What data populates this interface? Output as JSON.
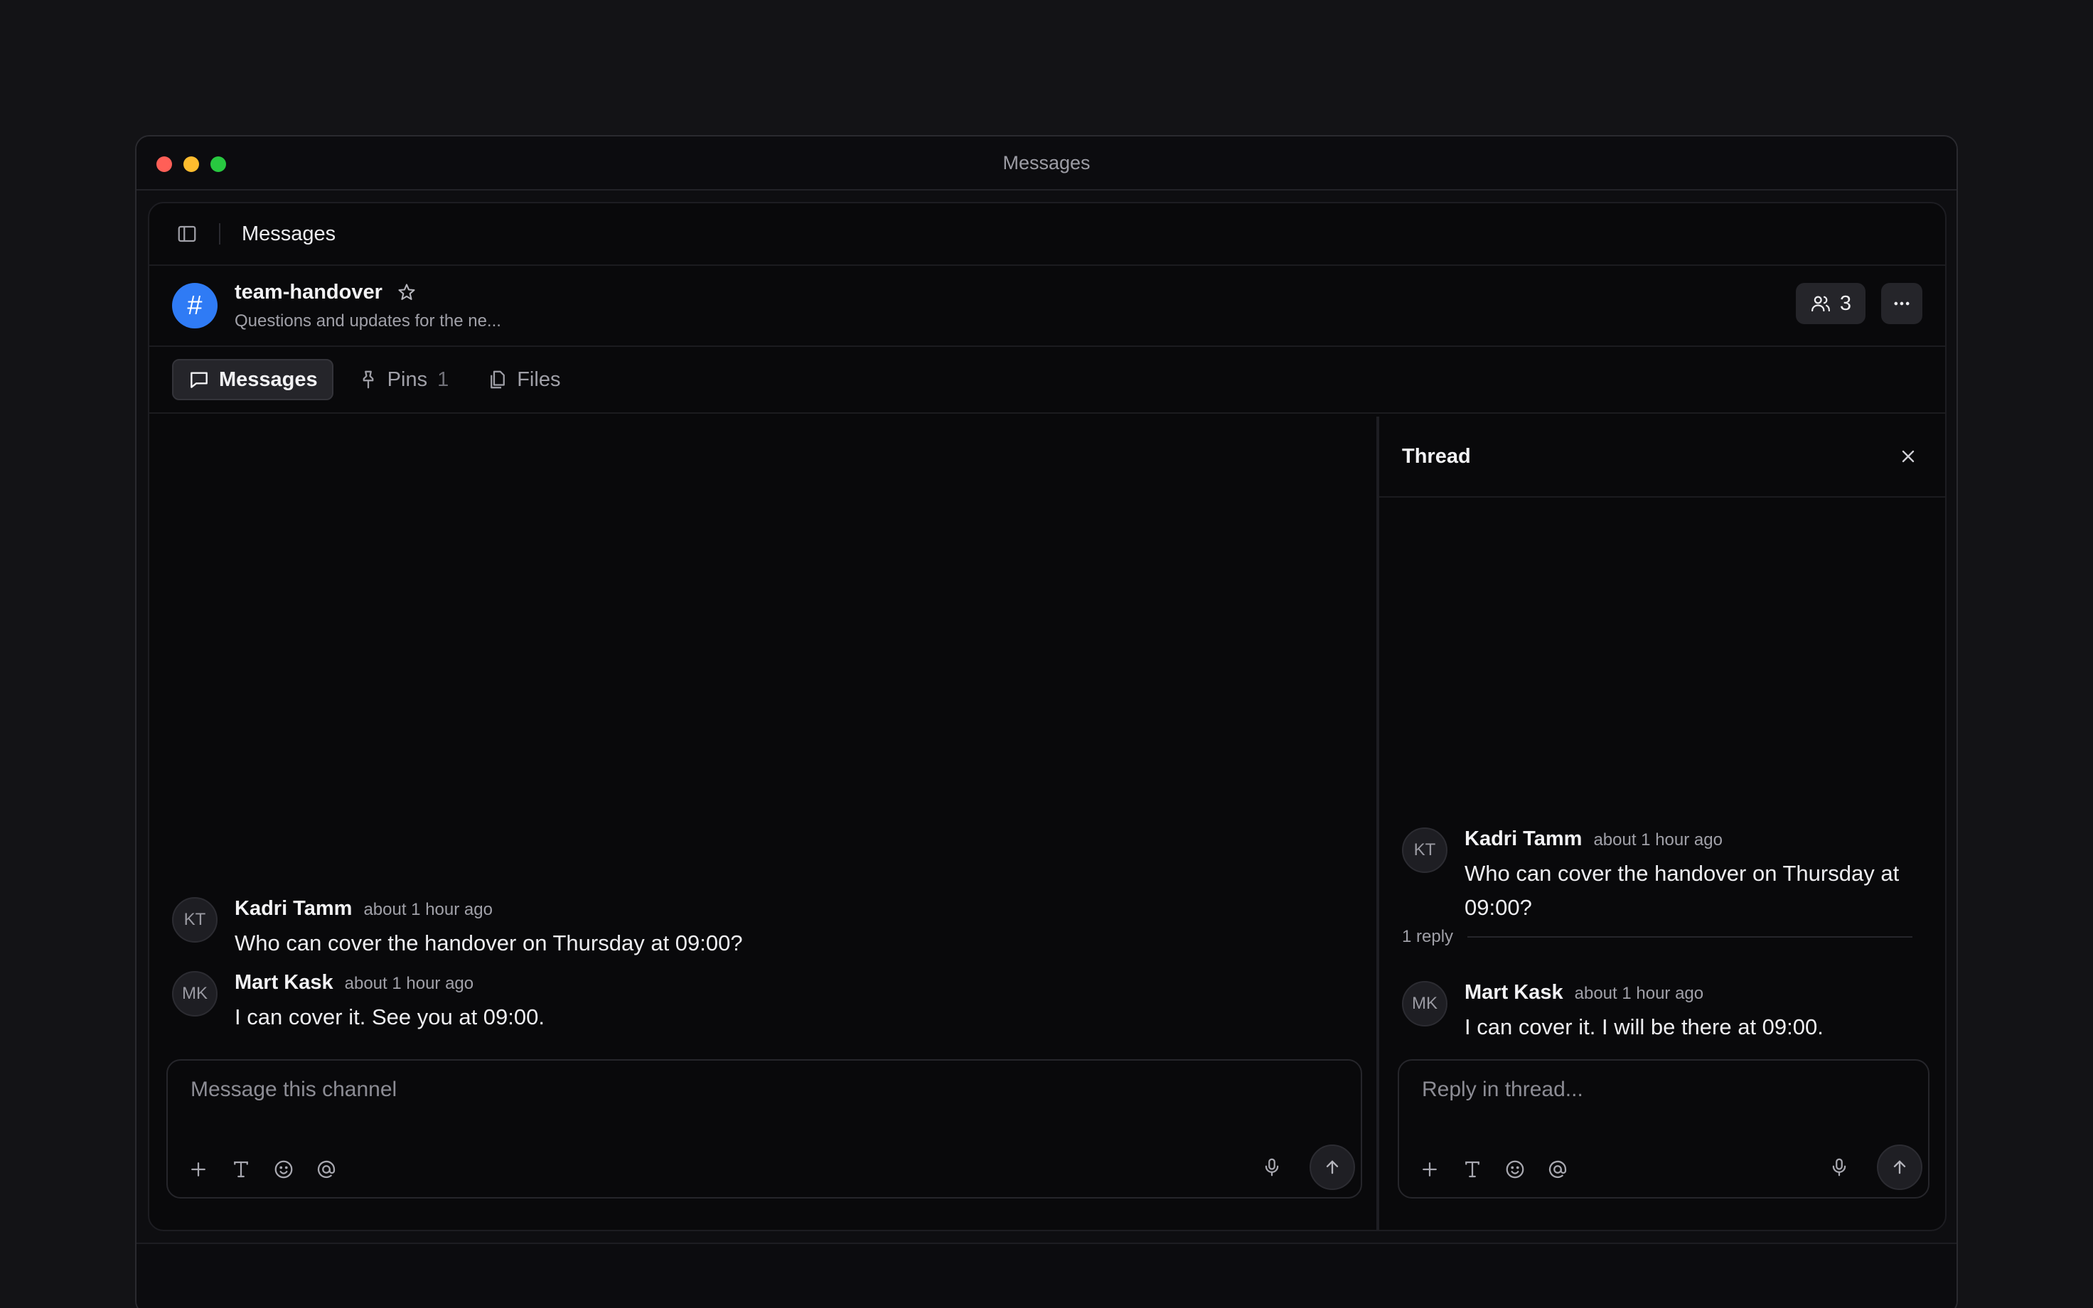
{
  "window": {
    "title": "Messages"
  },
  "breadcrumb": {
    "current": "Messages"
  },
  "channel": {
    "symbol": "#",
    "name": "team-handover",
    "description": "Questions and updates for the ne...",
    "member_count": "3"
  },
  "tabs": [
    {
      "label": "Messages",
      "count": ""
    },
    {
      "label": "Pins",
      "count": "1"
    },
    {
      "label": "Files",
      "count": ""
    }
  ],
  "messages": [
    {
      "initials": "KT",
      "author": "Kadri Tamm",
      "time": "about 1 hour ago",
      "text": "Who can cover the handover on Thursday at 09:00?"
    },
    {
      "initials": "MK",
      "author": "Mart Kask",
      "time": "about 1 hour ago",
      "text": "I can cover it. See you at 09:00."
    }
  ],
  "composer": {
    "placeholder": "Message this channel"
  },
  "thread": {
    "title": "Thread",
    "parent": {
      "initials": "KT",
      "author": "Kadri Tamm",
      "time": "about 1 hour ago",
      "text": "Who can cover the handover on Thursday at 09:00?"
    },
    "reply_count_label": "1 reply",
    "reply": {
      "initials": "MK",
      "author": "Mart Kask",
      "time": "about 1 hour ago",
      "text": "I can cover it. I will be there at 09:00."
    },
    "composer_placeholder": "Reply in thread..."
  },
  "colors": {
    "accent": "#2f7bf5",
    "background": "#09090b",
    "surface": "#25252a"
  }
}
